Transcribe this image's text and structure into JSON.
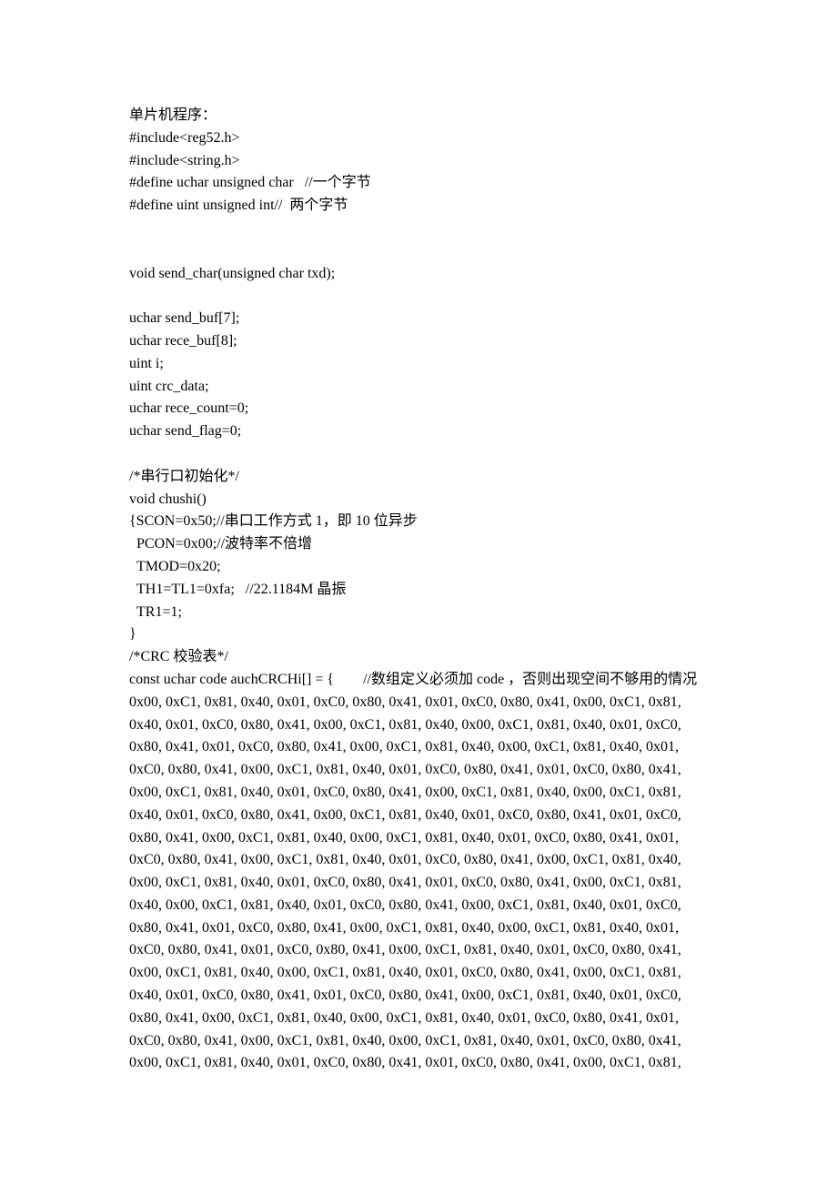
{
  "lines": [
    "单片机程序：",
    "#include<reg52.h>",
    "#include<string.h>",
    "#define uchar unsigned char   //一个字节",
    "#define uint unsigned int//  两个字节",
    "",
    "",
    "void send_char(unsigned char txd);",
    "",
    "uchar send_buf[7];",
    "uchar rece_buf[8];",
    "uint i;",
    "uint crc_data;",
    "uchar rece_count=0;",
    "uchar send_flag=0;",
    "",
    "/*串行口初始化*/",
    "void chushi()",
    "{SCON=0x50;//串口工作方式 1，即 10 位异步",
    "  PCON=0x00;//波特率不倍增",
    "  TMOD=0x20;",
    "  TH1=TL1=0xfa;   //22.1184M 晶振",
    "  TR1=1;",
    "}",
    "/*CRC 校验表*/",
    "const uchar code auchCRCHi[] = {        //数组定义必须加 code ，否则出现空间不够用的情况",
    "0x00, 0xC1, 0x81, 0x40, 0x01, 0xC0, 0x80, 0x41, 0x01, 0xC0, 0x80, 0x41, 0x00, 0xC1, 0x81,",
    "0x40, 0x01, 0xC0, 0x80, 0x41, 0x00, 0xC1, 0x81, 0x40, 0x00, 0xC1, 0x81, 0x40, 0x01, 0xC0,",
    "0x80, 0x41, 0x01, 0xC0, 0x80, 0x41, 0x00, 0xC1, 0x81, 0x40, 0x00, 0xC1, 0x81, 0x40, 0x01,",
    "0xC0, 0x80, 0x41, 0x00, 0xC1, 0x81, 0x40, 0x01, 0xC0, 0x80, 0x41, 0x01, 0xC0, 0x80, 0x41,",
    "0x00, 0xC1, 0x81, 0x40, 0x01, 0xC0, 0x80, 0x41, 0x00, 0xC1, 0x81, 0x40, 0x00, 0xC1, 0x81,",
    "0x40, 0x01, 0xC0, 0x80, 0x41, 0x00, 0xC1, 0x81, 0x40, 0x01, 0xC0, 0x80, 0x41, 0x01, 0xC0,",
    "0x80, 0x41, 0x00, 0xC1, 0x81, 0x40, 0x00, 0xC1, 0x81, 0x40, 0x01, 0xC0, 0x80, 0x41, 0x01,",
    "0xC0, 0x80, 0x41, 0x00, 0xC1, 0x81, 0x40, 0x01, 0xC0, 0x80, 0x41, 0x00, 0xC1, 0x81, 0x40,",
    "0x00, 0xC1, 0x81, 0x40, 0x01, 0xC0, 0x80, 0x41, 0x01, 0xC0, 0x80, 0x41, 0x00, 0xC1, 0x81,",
    "0x40, 0x00, 0xC1, 0x81, 0x40, 0x01, 0xC0, 0x80, 0x41, 0x00, 0xC1, 0x81, 0x40, 0x01, 0xC0,",
    "0x80, 0x41, 0x01, 0xC0, 0x80, 0x41, 0x00, 0xC1, 0x81, 0x40, 0x00, 0xC1, 0x81, 0x40, 0x01,",
    "0xC0, 0x80, 0x41, 0x01, 0xC0, 0x80, 0x41, 0x00, 0xC1, 0x81, 0x40, 0x01, 0xC0, 0x80, 0x41,",
    "0x00, 0xC1, 0x81, 0x40, 0x00, 0xC1, 0x81, 0x40, 0x01, 0xC0, 0x80, 0x41, 0x00, 0xC1, 0x81,",
    "0x40, 0x01, 0xC0, 0x80, 0x41, 0x01, 0xC0, 0x80, 0x41, 0x00, 0xC1, 0x81, 0x40, 0x01, 0xC0,",
    "0x80, 0x41, 0x00, 0xC1, 0x81, 0x40, 0x00, 0xC1, 0x81, 0x40, 0x01, 0xC0, 0x80, 0x41, 0x01,",
    "0xC0, 0x80, 0x41, 0x00, 0xC1, 0x81, 0x40, 0x00, 0xC1, 0x81, 0x40, 0x01, 0xC0, 0x80, 0x41,",
    "0x00, 0xC1, 0x81, 0x40, 0x01, 0xC0, 0x80, 0x41, 0x01, 0xC0, 0x80, 0x41, 0x00, 0xC1, 0x81,"
  ]
}
